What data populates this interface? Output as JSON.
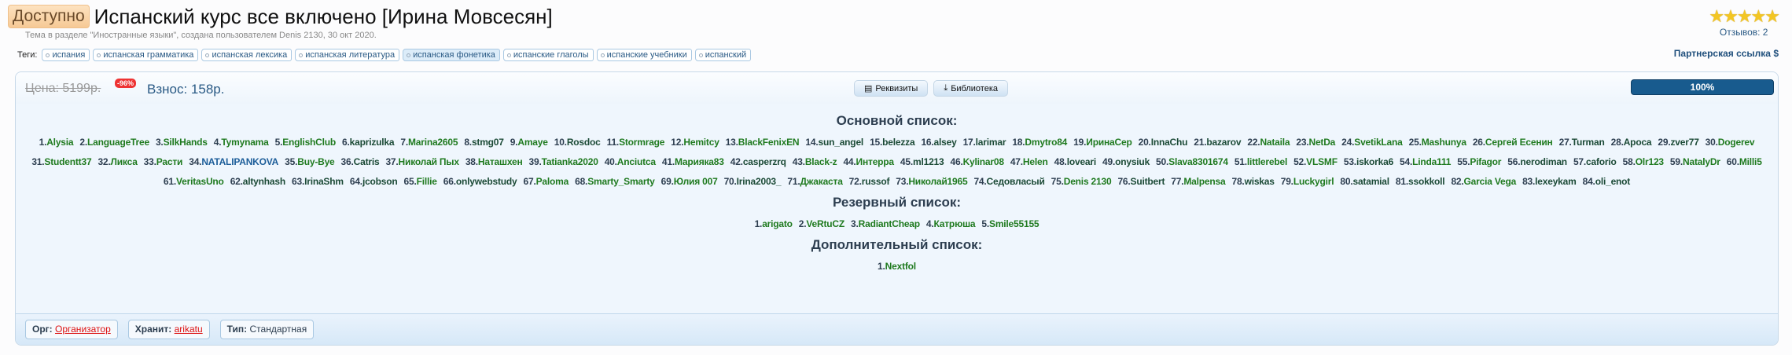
{
  "header": {
    "badge": "Доступно",
    "title": "Испанский курс все включено [Ирина Мовсесян]",
    "meta": "Тема в разделе \"Иностранные языки\", создана пользователем Denis 2130, 30 окт 2020.",
    "tags_label": "Теги:",
    "tags": [
      "испания",
      "испанская грамматика",
      "испанская лексика",
      "испанская литература",
      "испанская фонетика",
      "испанские глаголы",
      "испанские учебники",
      "испанский"
    ],
    "rating_stars": 5,
    "stars": "★★★★★",
    "reviews": "Отзывов: 2",
    "partner": "Партнерская ссылка $"
  },
  "panel": {
    "price": "Цена: 5199р.",
    "discount": "-96%",
    "fee": "Взнос: 158р.",
    "btn_requisites": "Реквизиты",
    "btn_library": "Библиотека",
    "progress_label": "100%",
    "progress": 100
  },
  "main_title": "Основной список:",
  "main": [
    "Alysia",
    "LanguageTree",
    "SilkHands",
    "Tymynama",
    "EnglishClub",
    "kaprizulka",
    "Marina2605",
    "stmg07",
    "Amaye",
    "Rosdoc",
    "Stormrage",
    "Hemitcy",
    "BlackFenixEN",
    "sun_angel",
    "belezza",
    "alsey",
    "larimar",
    "Dmytro84",
    "ИринаСер",
    "InnaChu",
    "bazarov",
    "Nataila",
    "NetDa",
    "SvetikLana",
    "Mashunya",
    "Сергей Есенин",
    "Turman",
    "Apoca",
    "zver77",
    "Dogerev",
    "Studentt37",
    "Ликса",
    "Расти",
    "NATALIPANKOVA",
    "Buy-Bye",
    "Catris",
    "Николай Пых",
    "Наташхен",
    "Tatianka2020",
    "Anciutca",
    "Марияка83",
    "casperzrq",
    "Black-z",
    "Интерра",
    "ml1213",
    "Kylinar08",
    "Helen",
    "loveari",
    "onysiuk",
    "Slava8301674",
    "littlerebel",
    "VLSMF",
    "iskorka6",
    "Linda111",
    "Pifagor",
    "nerodiman",
    "caforio",
    "Olr123",
    "NatalyDr",
    "Milli5",
    "VeritasUno",
    "altynhash",
    "IrinaShm",
    "jcobson",
    "Fillie",
    "onlywebstudy",
    "Paloma",
    "Smarty_Smarty",
    "Юлия 007",
    "Irina2003_",
    "Джакаста",
    "russof",
    "Николай1965",
    "Седовласый",
    "Denis 2130",
    "Suitbert",
    "Malpensa",
    "wiskas",
    "Luckygirl",
    "satamial",
    "ssokkoll",
    "Garcia Vega",
    "lexeykam",
    "oli_enot"
  ],
  "reserve_title": "Резервный список:",
  "reserve": [
    "arigato",
    "VeRtuCZ",
    "RadiantCheap",
    "Катрюша",
    "Smile55155"
  ],
  "extra_title": "Дополнительный список:",
  "extra": [
    "Nextfol"
  ],
  "footer": {
    "org_label": "Орг:",
    "org_value": "Организатор",
    "keeper_label": "Хранит:",
    "keeper_value": "arikatu",
    "type_label": "Тип:",
    "type_value": "Стандартная"
  }
}
